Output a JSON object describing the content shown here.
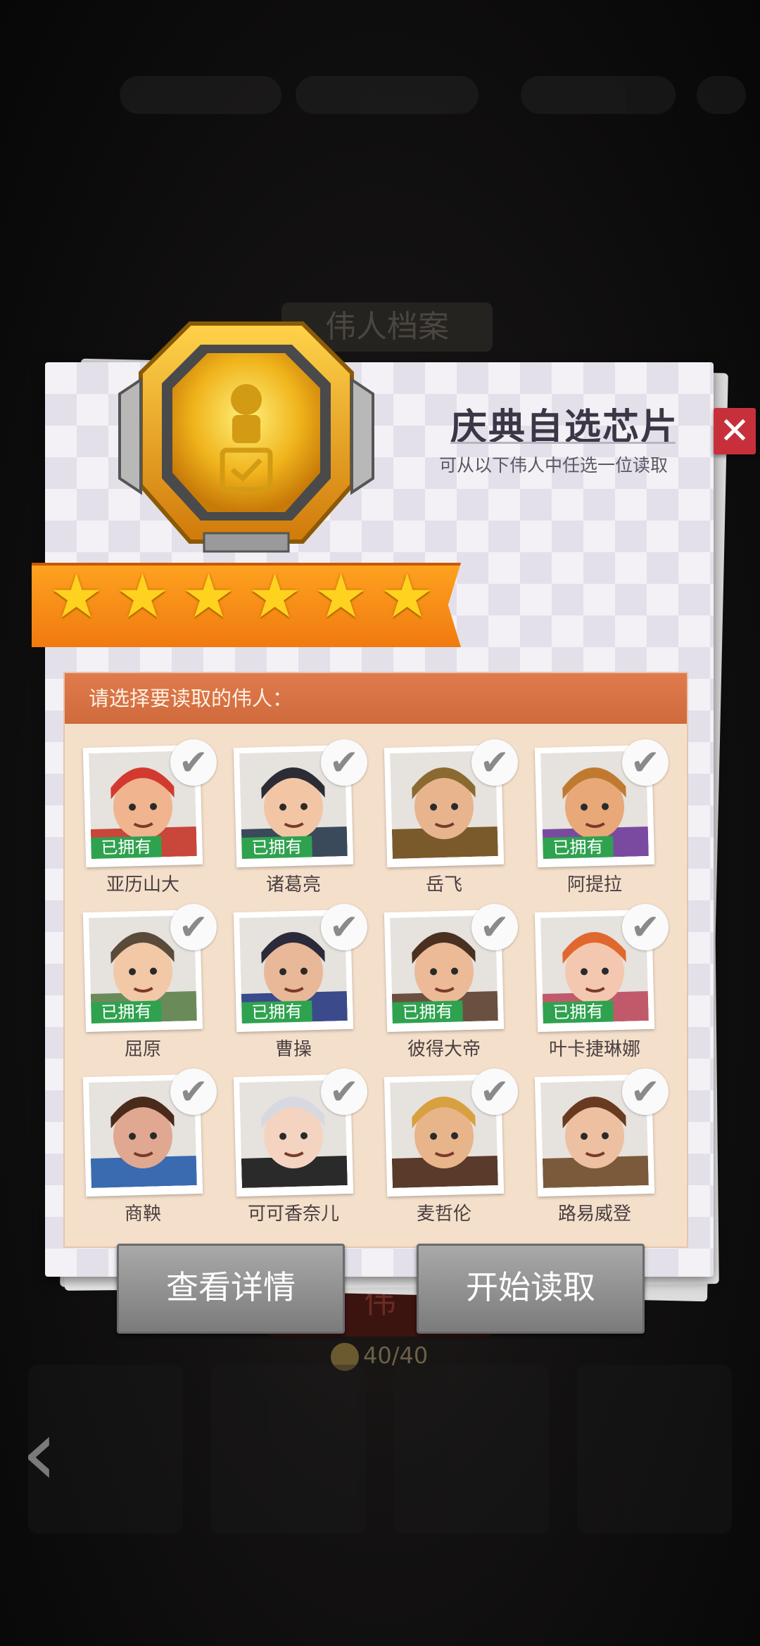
{
  "background": {
    "title": "伟人档案",
    "counter": "40/40"
  },
  "dialog": {
    "title": "庆典自选芯片",
    "subtitle": "可从以下伟人中任选一位读取",
    "close_label": "✕",
    "stars": 6,
    "prompt": "请选择要读取的伟人：",
    "owned_label": "已拥有",
    "heroes": [
      {
        "name": "亚历山大",
        "owned": true,
        "color": "#c8463a",
        "skin": "#f0b48e",
        "hair": "#d23a30"
      },
      {
        "name": "诸葛亮",
        "owned": true,
        "color": "#3a4a5a",
        "skin": "#f2c6a4",
        "hair": "#2c2c34"
      },
      {
        "name": "岳飞",
        "owned": false,
        "color": "#7a5a2a",
        "skin": "#e8b48e",
        "hair": "#8a6a30"
      },
      {
        "name": "阿提拉",
        "owned": true,
        "color": "#7a4aa0",
        "skin": "#e8a878",
        "hair": "#c07a30"
      },
      {
        "name": "屈原",
        "owned": true,
        "color": "#6a8a5a",
        "skin": "#f2c8a6",
        "hair": "#5a4a3a"
      },
      {
        "name": "曹操",
        "owned": true,
        "color": "#3a4a8a",
        "skin": "#e8b898",
        "hair": "#2a2a3a"
      },
      {
        "name": "彼得大帝",
        "owned": true,
        "color": "#6a5040",
        "skin": "#ecba96",
        "hair": "#4a3020"
      },
      {
        "name": "叶卡捷琳娜",
        "owned": true,
        "color": "#c05a6a",
        "skin": "#f4c8b0",
        "hair": "#e0682e"
      },
      {
        "name": "商鞅",
        "owned": false,
        "color": "#3a6ab0",
        "skin": "#e0a890",
        "hair": "#4a2a1a"
      },
      {
        "name": "可可香奈儿",
        "owned": false,
        "color": "#2a2a2a",
        "skin": "#f4d4c0",
        "hair": "#d8d8e0"
      },
      {
        "name": "麦哲伦",
        "owned": false,
        "color": "#5a3a2a",
        "skin": "#e8b48a",
        "hair": "#d8a040"
      },
      {
        "name": "路易威登",
        "owned": false,
        "color": "#7a5a3a",
        "skin": "#ecc0a0",
        "hair": "#6a3a20"
      }
    ],
    "buttons": {
      "detail": "查看详情",
      "start": "开始读取"
    }
  }
}
